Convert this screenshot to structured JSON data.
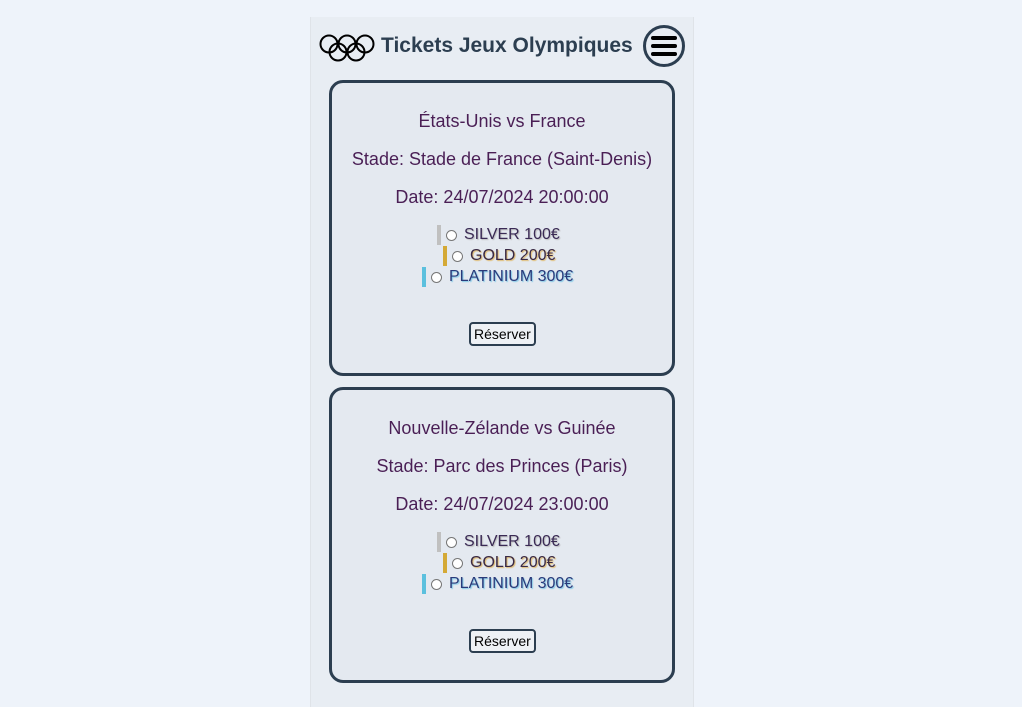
{
  "header": {
    "title": "Tickets Jeux Olympiques",
    "logo_icon": "olympic-rings-icon",
    "menu_icon": "hamburger-menu-icon"
  },
  "colors": {
    "primary": "#2c3e50",
    "text": "#4a1f55",
    "silver": "#c0c0c0",
    "gold": "#d4a936",
    "platinum": "#5bc0de"
  },
  "events": [
    {
      "match": "États-Unis vs France",
      "stadium": "Stade: Stade de France (Saint-Denis)",
      "date": "Date: 24/07/2024 20:00:00",
      "options": [
        {
          "label": "SILVER 100€",
          "color": "#c0c0c0"
        },
        {
          "label": "GOLD 200€",
          "color": "#d4a936"
        },
        {
          "label": "PLATINIUM 300€",
          "color": "#5bc0de"
        }
      ],
      "button": "Réserver"
    },
    {
      "match": "Nouvelle-Zélande vs Guinée",
      "stadium": "Stade: Parc des Princes (Paris)",
      "date": "Date: 24/07/2024 23:00:00",
      "options": [
        {
          "label": "SILVER 100€",
          "color": "#c0c0c0"
        },
        {
          "label": "GOLD 200€",
          "color": "#d4a936"
        },
        {
          "label": "PLATINIUM 300€",
          "color": "#5bc0de"
        }
      ],
      "button": "Réserver"
    }
  ]
}
